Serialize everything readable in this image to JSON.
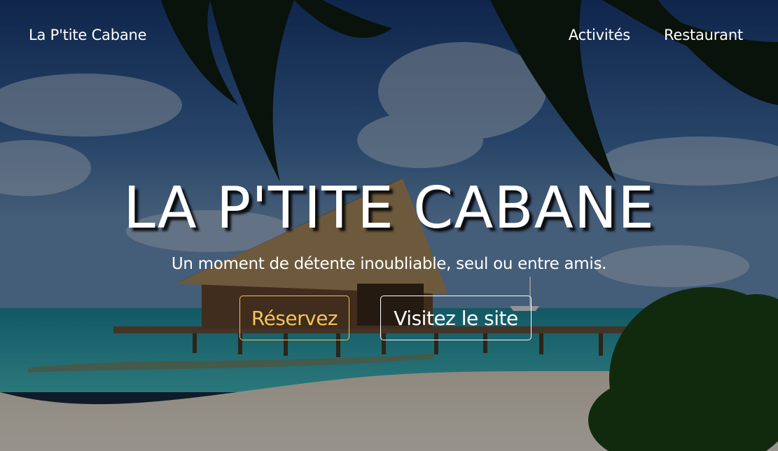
{
  "nav": {
    "brand": "La P'tite Cabane",
    "links": [
      {
        "label": "Activités"
      },
      {
        "label": "Restaurant"
      }
    ]
  },
  "hero": {
    "title": "LA P'TITE CABANE",
    "subtitle": "Un moment de détente inoubliable, seul ou entre amis.",
    "buttons": {
      "reserve": "Réservez",
      "visit": "Visitez le site"
    }
  },
  "colors": {
    "accent": "#f2c45c",
    "text": "#ffffff",
    "overlay": "rgba(0,0,0,0.45)"
  }
}
